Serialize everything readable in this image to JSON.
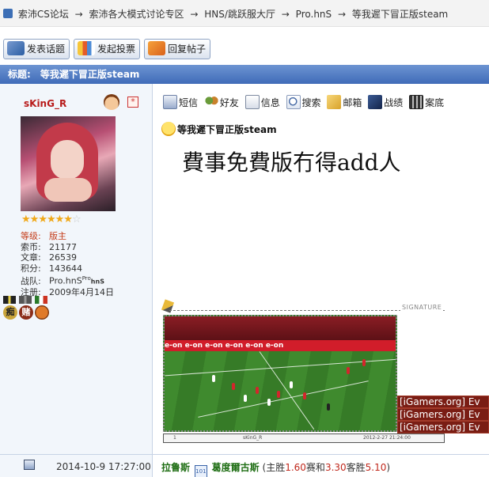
{
  "breadcrumb": {
    "items": [
      "索沛CS论坛",
      "索沛各大模式讨论专区",
      "HNS/跳跃服大厅",
      "Pro.hnS",
      "等我遲下冒正版steam"
    ],
    "separator": "→"
  },
  "actions": {
    "new_topic": "发表话题",
    "new_poll": "发起投票",
    "reply": "回复帖子"
  },
  "thread": {
    "title_label": "标题:",
    "title": "等我遲下冒正版steam"
  },
  "author": {
    "name": "sKinG_R",
    "stars_filled": 6,
    "stars_total": 7,
    "level_label": "等级:",
    "level": "版主",
    "coins_label": "索币:",
    "coins": "21177",
    "posts_label": "文章:",
    "posts": "26539",
    "points_label": "积分:",
    "points": "143644",
    "team_label": "战队:",
    "team": "Pro.hnS",
    "team_sup": "Pro",
    "team_small": "hnS",
    "joined_label": "注册:",
    "joined": "2009年4月14日",
    "medal_texts": [
      "痴",
      "赌"
    ]
  },
  "toolbar": {
    "sms": "短信",
    "friend": "好友",
    "info": "信息",
    "search": "搜索",
    "mail": "邮箱",
    "battle": "战绩",
    "record": "案底"
  },
  "post": {
    "title": "等我遲下冒正版steam",
    "body": "費事免費版冇得add人",
    "signature_label": "SIGNATURE",
    "sig_board_text": "e-on   e-on   e-on   e-on   e-on   e-on",
    "sig_strip": {
      "left": "1",
      "center": "sKinG_R",
      "right": "2012-2-27 21:24:00"
    },
    "ig_banners": [
      "[iGamers.org] Ev",
      "[iGamers.org] Ev",
      "[iGamers.org] Ev"
    ]
  },
  "footer": {
    "time": "2014-10-9 17:27:00",
    "team_home": "拉鲁斯",
    "vs_icon_text": "101",
    "team_away": "葛度爾古斯",
    "odds_open": "(主胜",
    "odd_home": "1.60",
    "odd_draw_label": "赛和",
    "odd_draw": "3.30",
    "odd_away_label": "客胜",
    "odd_away": "5.10",
    "odds_close": ")"
  },
  "colors": {
    "title_bar": "#4f7cc4",
    "username": "#b81b1b",
    "level": "#c43c1a",
    "team_name": "#1f6e14",
    "odds": "#c0281c",
    "banner": "#7a1d14"
  }
}
